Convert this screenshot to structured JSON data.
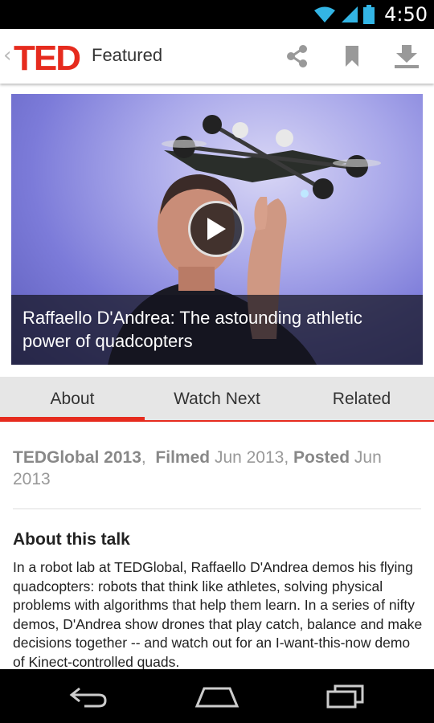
{
  "status_bar": {
    "time": "4:50"
  },
  "action_bar": {
    "logo_text": "TED",
    "title": "Featured",
    "share_icon": "share-icon",
    "bookmark_icon": "bookmark-icon",
    "download_icon": "download-icon"
  },
  "hero": {
    "title": "Raffaello D'Andrea: The astounding athletic power of quadcopters",
    "play_icon": "play-icon"
  },
  "tabs": [
    {
      "label": "About",
      "active": true
    },
    {
      "label": "Watch Next",
      "active": false
    },
    {
      "label": "Related",
      "active": false
    }
  ],
  "meta": {
    "event": "TEDGlobal 2013",
    "sep": ",",
    "filmed_label": "Filmed",
    "filmed_value": "Jun 2013",
    "posted_label": "Posted",
    "posted_value": "Jun 2013"
  },
  "about": {
    "heading": "About this talk",
    "body": "In a robot lab at TEDGlobal, Raffaello D'Andrea demos his flying quadcopters: robots that think like athletes, solving physical problems with algorithms that help them learn. In a series of nifty demos, D'Andrea show drones that play catch, balance and make decisions together -- and watch out for an I-want-this-now demo of Kinect-controlled quads."
  },
  "colors": {
    "accent": "#e62b1e",
    "tab_bg": "#e6e6e6"
  }
}
